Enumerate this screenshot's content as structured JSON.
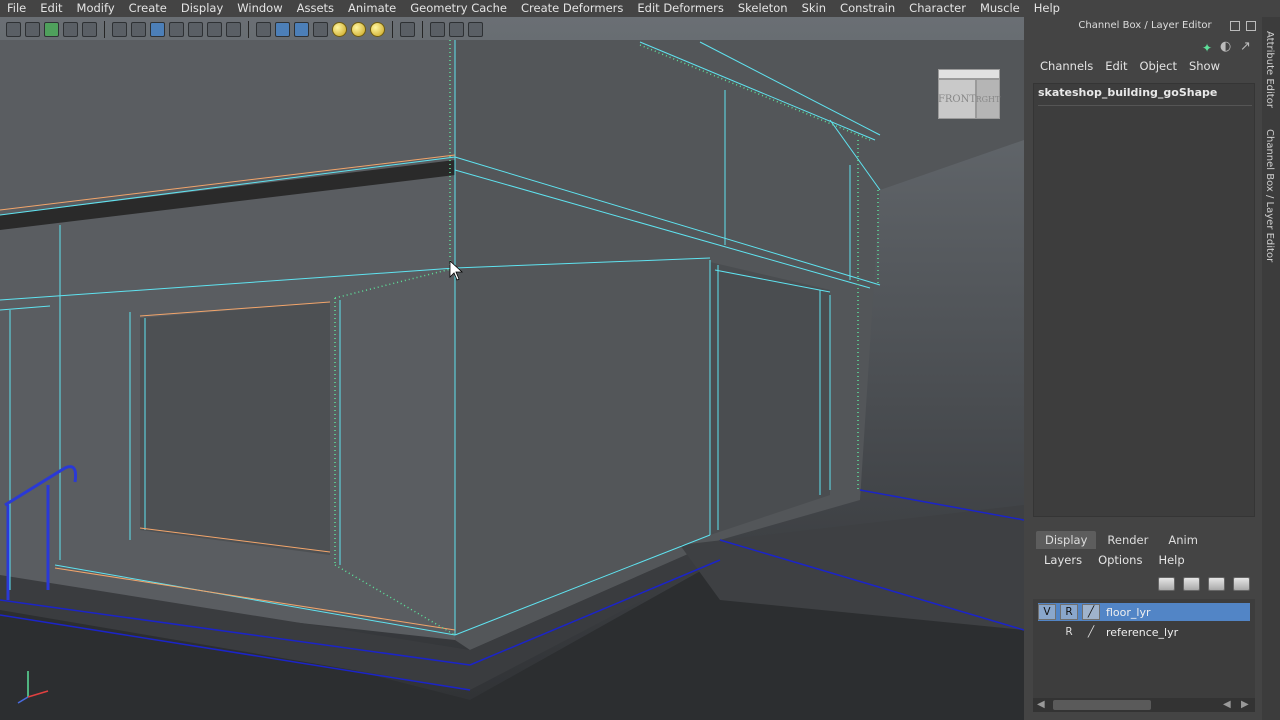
{
  "menubar": {
    "items": [
      "File",
      "Edit",
      "Modify",
      "Create",
      "Display",
      "Window",
      "Assets",
      "Animate",
      "Geometry Cache",
      "Create Deformers",
      "Edit Deformers",
      "Skeleton",
      "Skin",
      "Constrain",
      "Character",
      "Muscle",
      "Help"
    ]
  },
  "viewport": {
    "viewcube": {
      "front_label": "FRONT",
      "right_label": "RGHT"
    },
    "toolbar_icons": [
      "select-camera",
      "lock-camera",
      "camera-attributes",
      "bookmarks",
      "image-plane",
      "grid",
      "film-gate",
      "resolution-gate",
      "field-chart",
      "safe-action",
      "wireframe",
      "smooth-shade",
      "shade-all",
      "wireframe-on-shaded",
      "textured",
      "use-all-lights",
      "shadows",
      "isolate-select",
      "xray",
      "xray-joints",
      "xray-active"
    ],
    "colors": {
      "wire": "#5fe3f0",
      "selected_edge": "#f2a56b",
      "component": "#5de09a",
      "floor_line": "#1b24c8"
    }
  },
  "panel": {
    "title": "Channel Box / Layer Editor",
    "channel_menu": [
      "Channels",
      "Edit",
      "Object",
      "Show"
    ],
    "object_name": "skateshop_building_goShape",
    "tabs": [
      "Display",
      "Render",
      "Anim"
    ],
    "active_tab": "Display",
    "layer_menu": [
      "Layers",
      "Options",
      "Help"
    ],
    "layers": [
      {
        "visible": "V",
        "reference": "R",
        "name": "floor_lyr",
        "selected": true
      },
      {
        "visible": "",
        "reference": "R",
        "name": "reference_lyr",
        "selected": false
      }
    ]
  },
  "side_tabs": [
    "Attribute Editor",
    "Channel Box / Layer Editor"
  ]
}
